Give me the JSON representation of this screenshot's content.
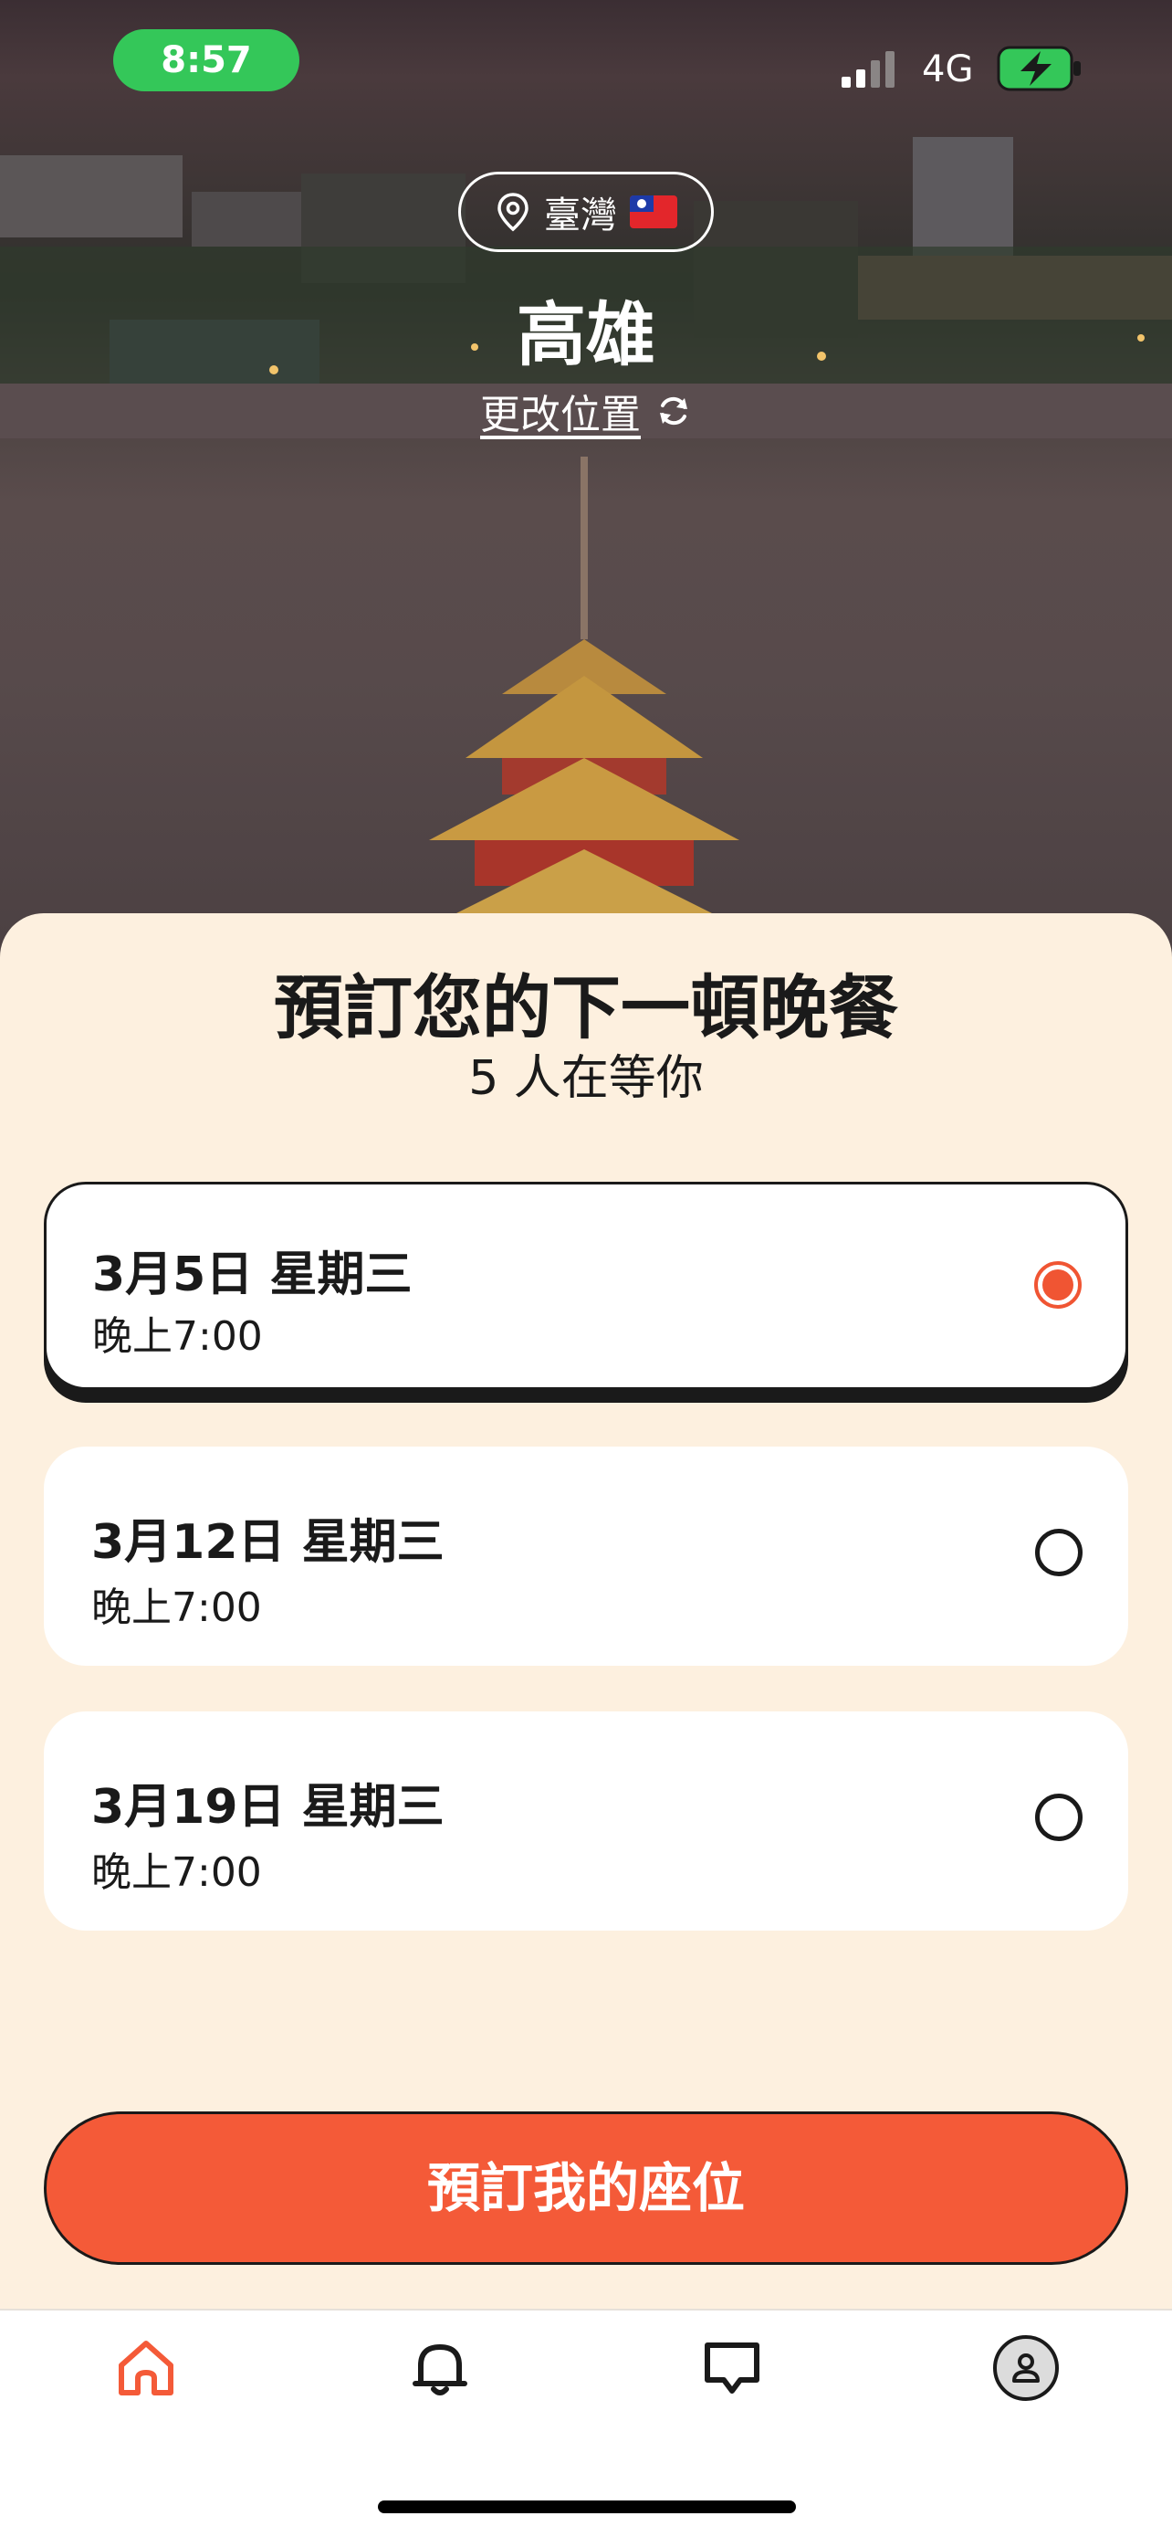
{
  "status_bar": {
    "time": "8:57",
    "network": "4G"
  },
  "location": {
    "country": "臺灣",
    "city": "高雄",
    "change_label": "更改位置"
  },
  "sheet": {
    "title": "預訂您的下一頓晚餐",
    "subtitle": "5 人在等你",
    "options": [
      {
        "date": "3月5日 星期三",
        "time": "晚上7:00",
        "selected": true
      },
      {
        "date": "3月12日 星期三",
        "time": "晚上7:00",
        "selected": false
      },
      {
        "date": "3月19日 星期三",
        "time": "晚上7:00",
        "selected": false
      }
    ],
    "cta_label": "預訂我的座位"
  },
  "tabs": [
    {
      "icon": "home-icon",
      "active": true
    },
    {
      "icon": "bell-icon",
      "active": false
    },
    {
      "icon": "chat-icon",
      "active": false
    },
    {
      "icon": "profile-icon",
      "active": false
    }
  ],
  "colors": {
    "accent": "#f45a38",
    "sheet_bg": "#fdf0df",
    "status_green": "#34c759",
    "text": "#1a1a1a"
  }
}
